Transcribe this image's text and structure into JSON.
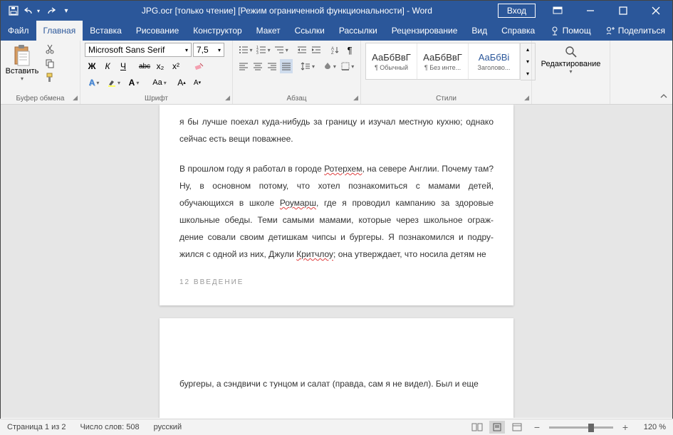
{
  "titlebar": {
    "title": "JPG.ocr [только чтение] [Режим ограниченной функциональности] - Word",
    "signin": "Вход"
  },
  "menu": {
    "file": "Файл",
    "home": "Главная",
    "insert": "Вставка",
    "draw": "Рисование",
    "design": "Конструктор",
    "layout": "Макет",
    "references": "Ссылки",
    "mailings": "Рассылки",
    "review": "Рецензирование",
    "view": "Вид",
    "help": "Справка",
    "tell": "Помощ",
    "share": "Поделиться"
  },
  "ribbon": {
    "clipboard": {
      "label": "Буфер обмена",
      "paste": "Вставить"
    },
    "font": {
      "label": "Шрифт",
      "name": "Microsoft Sans Serif",
      "size": "7,5",
      "bold": "Ж",
      "italic": "К",
      "underline": "Ч",
      "strike": "abc",
      "sub": "x₂",
      "sup": "x²"
    },
    "paragraph": {
      "label": "Абзац"
    },
    "styles": {
      "label": "Стили",
      "items": [
        {
          "preview": "АаБбВвГ",
          "name": "¶ Обычный"
        },
        {
          "preview": "АаБбВвГ",
          "name": "¶ Без инте..."
        },
        {
          "preview": "АаБбВі",
          "name": "Заголово..."
        }
      ]
    },
    "editing": {
      "label": "Редактирование"
    }
  },
  "document": {
    "p1": "я бы лучше поехал куда-нибудь за границу и изучал местную кухню; однако сейчас есть вещи поважнее.",
    "p2a": "В прошлом году я работал в городе ",
    "p2_word1": "Ротерхем",
    "p2b": ", на севере Англии. Почему там? Ну, в основном потому, что хотел познакомиться с мамами детей, обучающихся в школе ",
    "p2_word2": "Роумарш",
    "p2c": ", где я проводил кампанию за здоровые школьные обеды. Теми самыми мамами, которые через школьное ограж­дение совали своим детишкам чипсы и бургеры. Я познакомился и подру­жился с одной из них, Джули ",
    "p2_word3": "Критчлоу",
    "p2d": "; она утверждает, что носила детям не",
    "footer": "12 ВВЕДЕНИЕ",
    "p3": "бургеры, а сэндвичи с тунцом и салат (правда, сам я не видел). Был и еще"
  },
  "statusbar": {
    "page": "Страница 1 из 2",
    "words": "Число слов: 508",
    "lang": "русский",
    "zoom": "120 %"
  }
}
